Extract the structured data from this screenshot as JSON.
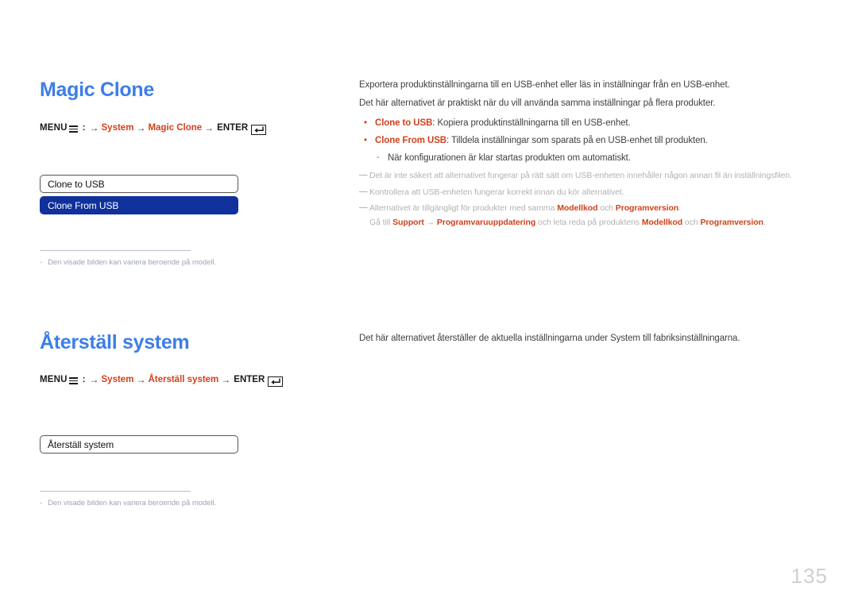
{
  "page": {
    "number": "135",
    "language": "sv"
  },
  "sections": [
    {
      "id": "magic-clone",
      "title": "Magic Clone",
      "menu_path": {
        "menu_label": "MENU",
        "menu_icon": "menu-bars-icon",
        "separator": ":",
        "arrow": "→",
        "items": [
          "System",
          "Magic Clone"
        ],
        "enter_label": "ENTER",
        "enter_icon": "enter-return-key-icon"
      },
      "osd_options": [
        {
          "label": "Clone to USB",
          "selected": false
        },
        {
          "label": "Clone From USB",
          "selected": true
        }
      ],
      "figure_note": {
        "dash": "-",
        "text": "Den visade bilden kan variera beroende på modell."
      },
      "body": [
        {
          "type": "paragraph",
          "text": "Exportera produktinställningarna till en USB-enhet eller läs in inställningar från en USB-enhet."
        },
        {
          "type": "paragraph",
          "text": "Det här alternativet är praktiskt när du vill använda samma inställningar på flera produkter."
        },
        {
          "type": "bullet",
          "bullet": "•",
          "keyword": "Clone to USB",
          "text": ": Kopiera produktinställningarna till en USB-enhet."
        },
        {
          "type": "bullet",
          "bullet": "•",
          "keyword": "Clone From USB",
          "text": ": Tilldela inställningar som sparats på en USB-enhet till produkten."
        },
        {
          "type": "subbullet",
          "bullet": "-",
          "text": "När konfigurationen är klar startas produkten om automatiskt."
        }
      ],
      "notes": [
        {
          "dash": "—",
          "text": "Det är inte säkert att alternativet fungerar på rätt sätt om USB-enheten innehåller någon annan fil än inställningsfilen."
        },
        {
          "dash": "—",
          "text": "Kontrollera att USB-enheten fungerar korrekt innan du kör alternativet."
        },
        {
          "dash": "—",
          "rich": [
            {
              "t": "Alternativet är tillgängligt för produkter med samma "
            },
            {
              "t": "Modellkod",
              "kw": true
            },
            {
              "t": " och "
            },
            {
              "t": "Programversion",
              "kw": true
            },
            {
              "t": "."
            }
          ]
        },
        {
          "dash": "",
          "sub": true,
          "rich": [
            {
              "t": "Gå till "
            },
            {
              "t": "Support",
              "kw": true
            },
            {
              "t": " → "
            },
            {
              "t": "Programvaruuppdatering",
              "kw": true
            },
            {
              "t": " och leta reda på produktens "
            },
            {
              "t": "Modellkod",
              "kw": true
            },
            {
              "t": " och "
            },
            {
              "t": "Programversion",
              "kw": true
            },
            {
              "t": "."
            }
          ]
        }
      ]
    },
    {
      "id": "aterstall-system",
      "title": "Återställ system",
      "menu_path": {
        "menu_label": "MENU",
        "menu_icon": "menu-bars-icon",
        "separator": ":",
        "arrow": "→",
        "items": [
          "System",
          "Återställ system"
        ],
        "enter_label": "ENTER",
        "enter_icon": "enter-return-key-icon"
      },
      "osd_options": [
        {
          "label": "Återställ system",
          "selected": false
        }
      ],
      "figure_note": {
        "dash": "-",
        "text": "Den visade bilden kan variera beroende på modell."
      },
      "body": [
        {
          "type": "paragraph",
          "text": "Det här alternativet återställer de aktuella inställningarna under System till fabriksinställningarna."
        }
      ],
      "notes": []
    }
  ],
  "colors": {
    "heading": "#3d7ee8",
    "accent": "#d2401c",
    "selected_option_bg": "#10309c",
    "body_text": "#3f3f3f",
    "note_text": "#b2b2b2",
    "figure_note_text": "#9ea3bb",
    "page_number": "#cfcfcf"
  }
}
